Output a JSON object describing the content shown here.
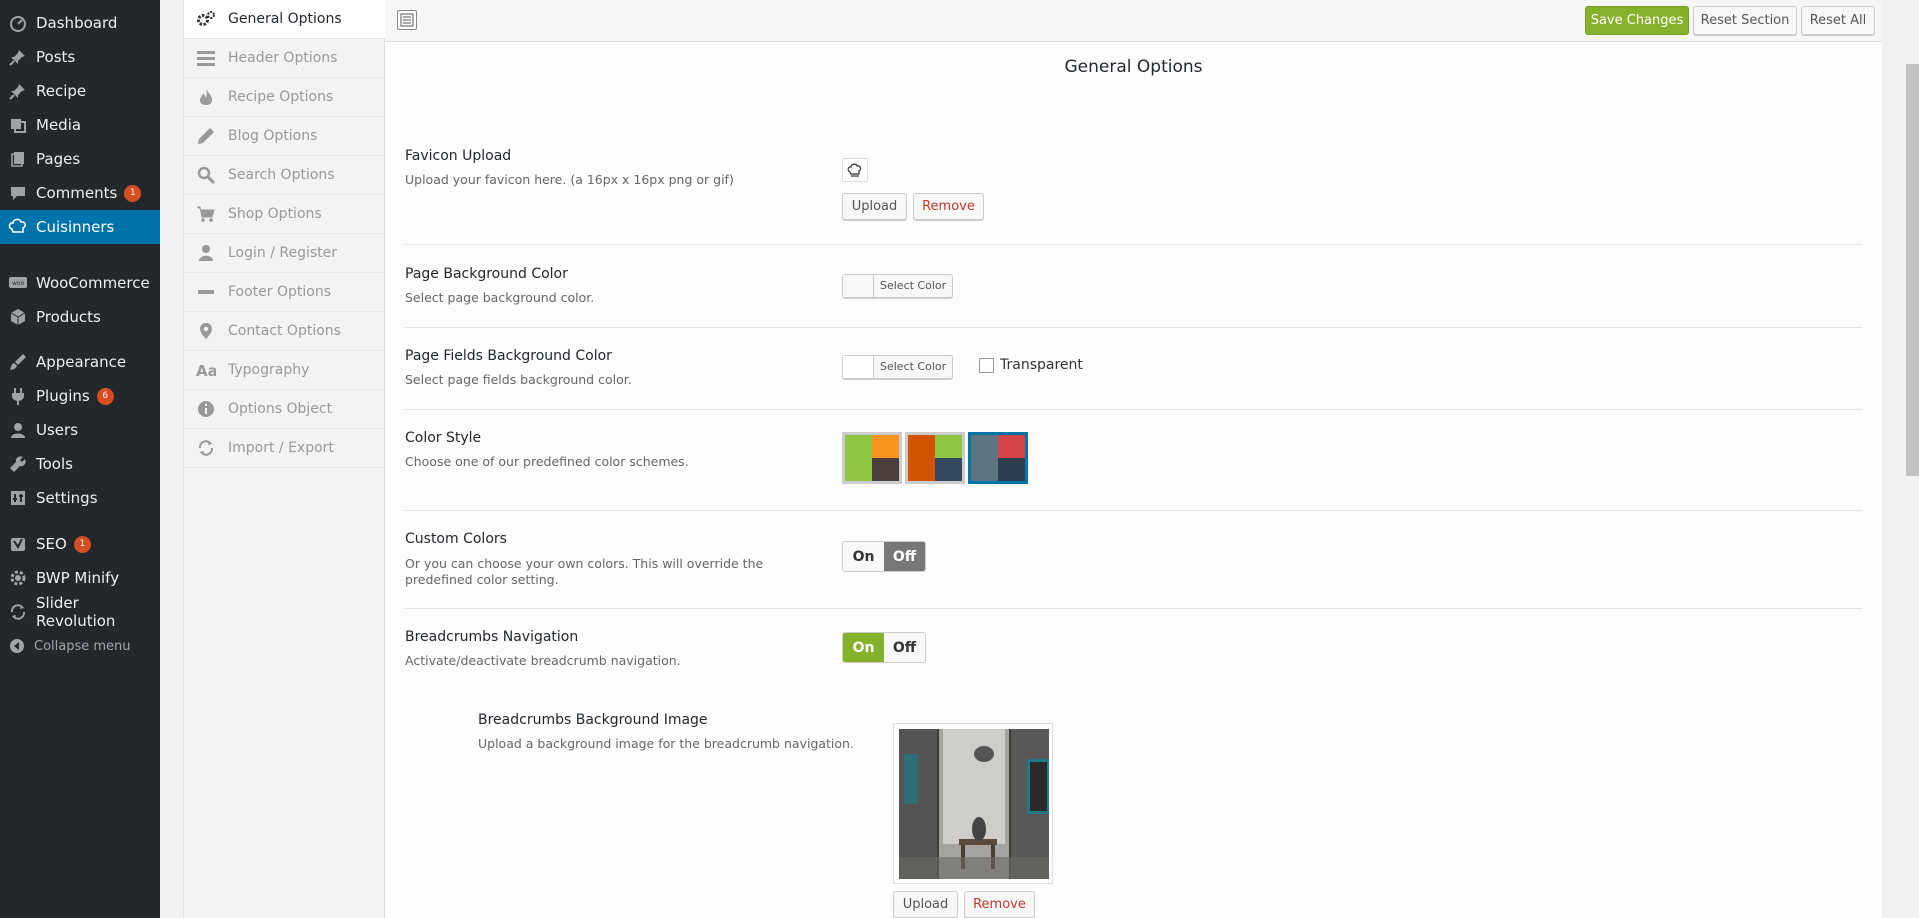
{
  "wp_menu": {
    "items": [
      {
        "label": "Dashboard",
        "icon": "dashboard-icon"
      },
      {
        "label": "Posts",
        "icon": "pin-icon"
      },
      {
        "label": "Recipe",
        "icon": "pin-icon"
      },
      {
        "label": "Media",
        "icon": "media-icon"
      },
      {
        "label": "Pages",
        "icon": "pages-icon"
      },
      {
        "label": "Comments",
        "icon": "comment-icon",
        "badge": "1"
      },
      {
        "label": "Cuisinners",
        "icon": "chef-hat-icon",
        "active": true
      },
      {
        "label": "WooCommerce",
        "icon": "woo-icon"
      },
      {
        "label": "Products",
        "icon": "box-icon"
      },
      {
        "label": "Appearance",
        "icon": "brush-icon"
      },
      {
        "label": "Plugins",
        "icon": "plug-icon",
        "badge": "6"
      },
      {
        "label": "Users",
        "icon": "user-icon"
      },
      {
        "label": "Tools",
        "icon": "wrench-icon"
      },
      {
        "label": "Settings",
        "icon": "settings-icon"
      },
      {
        "label": "SEO",
        "icon": "seo-icon",
        "badge": "1"
      },
      {
        "label": "BWP Minify",
        "icon": "gear-icon"
      },
      {
        "label": "Slider Revolution",
        "icon": "refresh-icon"
      }
    ],
    "collapse_label": "Collapse menu"
  },
  "options_nav": {
    "items": [
      {
        "label": "General Options",
        "icon": "gears-icon",
        "active": true
      },
      {
        "label": "Header Options",
        "icon": "lines-icon"
      },
      {
        "label": "Recipe Options",
        "icon": "flame-icon"
      },
      {
        "label": "Blog Options",
        "icon": "pencil-icon"
      },
      {
        "label": "Search Options",
        "icon": "search-icon"
      },
      {
        "label": "Shop Options",
        "icon": "cart-icon"
      },
      {
        "label": "Login / Register",
        "icon": "user-icon"
      },
      {
        "label": "Footer Options",
        "icon": "minus-icon"
      },
      {
        "label": "Contact Options",
        "icon": "location-pin-icon"
      },
      {
        "label": "Typography",
        "icon": "typography-icon"
      },
      {
        "label": "Options Object",
        "icon": "info-icon"
      },
      {
        "label": "Import / Export",
        "icon": "refresh-icon"
      }
    ]
  },
  "toolbar": {
    "save_label": "Save Changes",
    "reset_section_label": "Reset Section",
    "reset_all_label": "Reset All"
  },
  "section_title": "General Options",
  "favicon": {
    "title": "Favicon Upload",
    "desc": "Upload your favicon here. (a 16px x 16px png or gif)",
    "upload_label": "Upload",
    "remove_label": "Remove"
  },
  "page_bg": {
    "title": "Page Background Color",
    "desc": "Select page background color.",
    "select_label": "Select Color"
  },
  "fields_bg": {
    "title": "Page Fields Background Color",
    "desc": "Select page fields background color.",
    "select_label": "Select Color",
    "transparent_label": "Transparent"
  },
  "color_style": {
    "title": "Color Style",
    "desc": "Choose one of our predefined color schemes.",
    "schemes": [
      {
        "big": "#8dc63f",
        "tr": "#f7941d",
        "br": "#4a3f3a"
      },
      {
        "big": "#d35400",
        "tr": "#8dc63f",
        "br": "#34495e"
      },
      {
        "big": "#5d7481",
        "tr": "#d64545",
        "br": "#2c3e50",
        "selected": true
      }
    ]
  },
  "custom_colors": {
    "title": "Custom Colors",
    "desc": "Or you can choose your own colors. This will override the predefined color setting.",
    "on_label": "On",
    "off_label": "Off",
    "value": "off"
  },
  "breadcrumbs": {
    "title": "Breadcrumbs Navigation",
    "desc": "Activate/deactivate breadcrumb navigation.",
    "on_label": "On",
    "off_label": "Off",
    "value": "on"
  },
  "breadcrumbs_bg": {
    "title": "Breadcrumbs Background Image",
    "desc": "Upload a background image for the breadcrumb navigation.",
    "upload_label": "Upload",
    "remove_label": "Remove"
  },
  "colors": {
    "accent": "#86b22b",
    "wp_blue": "#0073aa",
    "danger": "#c0392b",
    "menu_bg": "#23282d"
  }
}
